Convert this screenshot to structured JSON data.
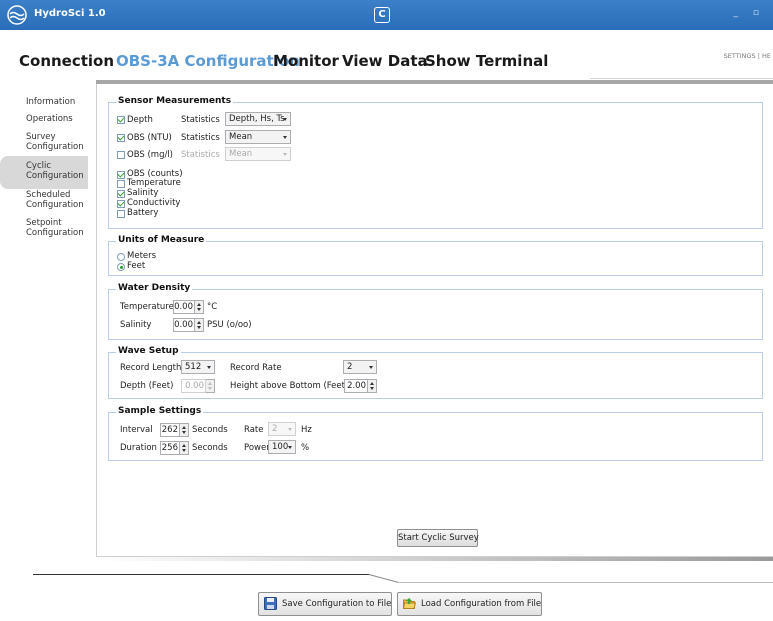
{
  "app": {
    "title": "HydroSci 1.0",
    "window_controls": "_ ▫"
  },
  "nav": {
    "tabs": [
      "Connection",
      "OBS-3A Configuration",
      "Monitor",
      "View Data",
      "Show Terminal"
    ],
    "active": "OBS-3A Configuration",
    "top_right": "SETTINGS  |  HE"
  },
  "sidebar": {
    "items": [
      "Information",
      "Operations",
      "Survey\nConfiguration",
      "Cyclic\nConfiguration",
      "Scheduled\nConfiguration",
      "Setpoint\nConfiguration"
    ],
    "active": "Cyclic\nConfiguration"
  },
  "sensor_measurements": {
    "title": "Sensor Measurements",
    "depth": {
      "label": "Depth",
      "checked": true,
      "stats_label": "Statistics",
      "stats_value": "Depth, Hs, Ts"
    },
    "obs_ntu": {
      "label": "OBS (NTU)",
      "checked": true,
      "stats_label": "Statistics",
      "stats_value": "Mean"
    },
    "obs_mgl": {
      "label": "OBS (mg/l)",
      "checked": false,
      "stats_label": "Statistics",
      "stats_value": "Mean"
    },
    "others": [
      {
        "label": "OBS (counts)",
        "checked": true
      },
      {
        "label": "Temperature",
        "checked": false
      },
      {
        "label": "Salinity",
        "checked": true
      },
      {
        "label": "Conductivity",
        "checked": true
      },
      {
        "label": "Battery",
        "checked": false
      }
    ]
  },
  "units": {
    "title": "Units of Measure",
    "options": [
      {
        "label": "Meters",
        "selected": false
      },
      {
        "label": "Feet",
        "selected": true
      }
    ]
  },
  "water_density": {
    "title": "Water Density",
    "temperature_label": "Temperature",
    "temperature_value": "0.00",
    "temperature_unit": "°C",
    "salinity_label": "Salinity",
    "salinity_value": "0.00",
    "salinity_unit": "PSU (o/oo)"
  },
  "wave_setup": {
    "title": "Wave Setup",
    "record_length_label": "Record Length",
    "record_length_value": "512",
    "record_rate_label": "Record Rate",
    "record_rate_value": "2",
    "depth_label": "Depth (Feet)",
    "depth_value": "0.00",
    "height_label": "Height above Bottom (Feet)",
    "height_value": "2.00"
  },
  "sample_settings": {
    "title": "Sample Settings",
    "interval_label": "Interval",
    "interval_value": "262",
    "interval_unit": "Seconds",
    "rate_label": "Rate",
    "rate_value": "2",
    "rate_unit": "Hz",
    "duration_label": "Duration",
    "duration_value": "256",
    "duration_unit": "Seconds",
    "power_label": "Power",
    "power_value": "100",
    "power_unit": "%"
  },
  "buttons": {
    "start": "Start Cyclic Survey",
    "save": "Save Configuration to File",
    "load": "Load Configuration from File"
  },
  "colors": {
    "titlebar": "#2f75c0",
    "active_tab": "#5b9bd5",
    "check": "#2a9d2a"
  },
  "icons": {
    "app": "hydrosci-logo-icon",
    "center": "campbell-logo-icon",
    "save": "floppy-disk-icon",
    "load": "open-folder-icon"
  }
}
